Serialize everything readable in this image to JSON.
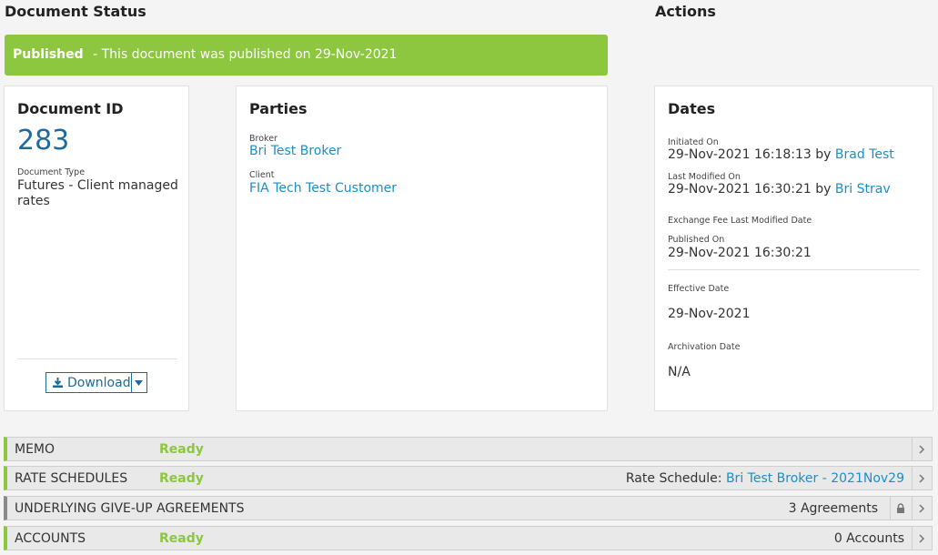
{
  "headers": {
    "status": "Document Status",
    "actions": "Actions"
  },
  "banner": {
    "bold": "Published",
    "text": " - This document was published on 29-Nov-2021",
    "color": "#8dc63f"
  },
  "doc": {
    "title": "Document ID",
    "id": "283",
    "type_label": "Document Type",
    "type_value": "Futures - Client managed rates",
    "download_label": "Download"
  },
  "parties": {
    "title": "Parties",
    "broker_label": "Broker",
    "broker": "Bri Test Broker",
    "client_label": "Client",
    "client": "FIA Tech Test Customer"
  },
  "dates": {
    "title": "Dates",
    "initiated_label": "Initiated On",
    "initiated_value": "29-Nov-2021 16:18:13 by",
    "initiated_by": "Brad Test",
    "modified_label": "Last Modified On",
    "modified_value": "29-Nov-2021 16:30:21 by",
    "modified_by": "Bri Strav",
    "exchange_label": "Exchange Fee Last Modified Date",
    "published_label": "Published On",
    "published_value": "29-Nov-2021 16:30:21",
    "effective_label": "Effective Date",
    "effective_value": "29-Nov-2021",
    "archivation_label": "Archivation Date",
    "archivation_value": "N/A"
  },
  "sections": [
    {
      "label": "MEMO",
      "status": "Ready",
      "right_text": "",
      "right_link": ""
    },
    {
      "label": "RATE SCHEDULES",
      "status": "Ready",
      "right_text": "Rate Schedule:",
      "right_link": "Bri Test Broker - 2021Nov29"
    },
    {
      "label": "UNDERLYING GIVE-UP AGREEMENTS",
      "status": "",
      "right_text": "3 Agreements",
      "right_link": ""
    },
    {
      "label": "ACCOUNTS",
      "status": "Ready",
      "right_text": "0 Accounts",
      "right_link": ""
    }
  ]
}
